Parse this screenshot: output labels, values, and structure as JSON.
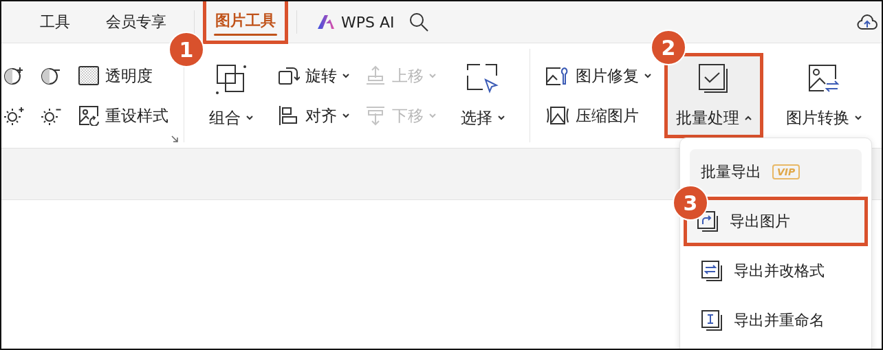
{
  "tabs": [
    {
      "label": "工具",
      "selected": false,
      "highlighted": false
    },
    {
      "label": "会员专享",
      "selected": false,
      "highlighted": false
    },
    {
      "label": "图片工具",
      "selected": true,
      "highlighted": true,
      "callout": "1"
    }
  ],
  "ai_button": {
    "label": "WPS AI"
  },
  "ribbon": {
    "groups": [
      {
        "launcher": true,
        "columns": [
          {
            "kind": "stack",
            "items": [
              {
                "kind": "icon"
              },
              {
                "kind": "icon"
              }
            ]
          },
          {
            "kind": "stack",
            "items": [
              {
                "kind": "icon"
              },
              {
                "kind": "icon"
              }
            ]
          },
          {
            "kind": "stack",
            "items": [
              {
                "kind": "text",
                "label": "透明度",
                "dropdown": false,
                "disabled": false
              },
              {
                "kind": "text",
                "label": "重设样式",
                "dropdown": false,
                "disabled": false
              }
            ]
          }
        ]
      },
      {
        "columns": [
          {
            "kind": "large",
            "label": "组合",
            "dropdown": true,
            "expanded": false,
            "highlighted": false
          },
          {
            "kind": "stack",
            "items": [
              {
                "kind": "text",
                "label": "旋转",
                "dropdown": true,
                "disabled": false
              },
              {
                "kind": "text",
                "label": "对齐",
                "dropdown": true,
                "disabled": false
              }
            ]
          },
          {
            "kind": "stack",
            "items": [
              {
                "kind": "text",
                "label": "上移",
                "dropdown": true,
                "disabled": true
              },
              {
                "kind": "text",
                "label": "下移",
                "dropdown": true,
                "disabled": true
              }
            ]
          },
          {
            "kind": "large",
            "label": "选择",
            "dropdown": true,
            "expanded": false,
            "highlighted": false
          }
        ]
      },
      {
        "columns": [
          {
            "kind": "stack",
            "items": [
              {
                "kind": "text",
                "label": "图片修复",
                "dropdown": true,
                "disabled": false
              },
              {
                "kind": "text",
                "label": "压缩图片",
                "dropdown": false,
                "disabled": false
              }
            ]
          },
          {
            "kind": "large",
            "label": "批量处理",
            "dropdown": true,
            "expanded": true,
            "highlighted": true,
            "callout": "2"
          },
          {
            "kind": "large",
            "label": "图片转换",
            "dropdown": true,
            "expanded": false,
            "highlighted": false
          }
        ]
      }
    ]
  },
  "menu": {
    "items": [
      {
        "kind": "plain",
        "label": "批量导出",
        "badge": "VIP",
        "hovered": true,
        "highlighted": false
      },
      {
        "kind": "icon",
        "label": "导出图片",
        "hovered": false,
        "highlighted": true,
        "callout": "3"
      },
      {
        "kind": "icon",
        "label": "导出并改格式",
        "hovered": false,
        "highlighted": false
      },
      {
        "kind": "icon",
        "label": "导出并重命名",
        "hovered": false,
        "highlighted": false
      }
    ]
  }
}
